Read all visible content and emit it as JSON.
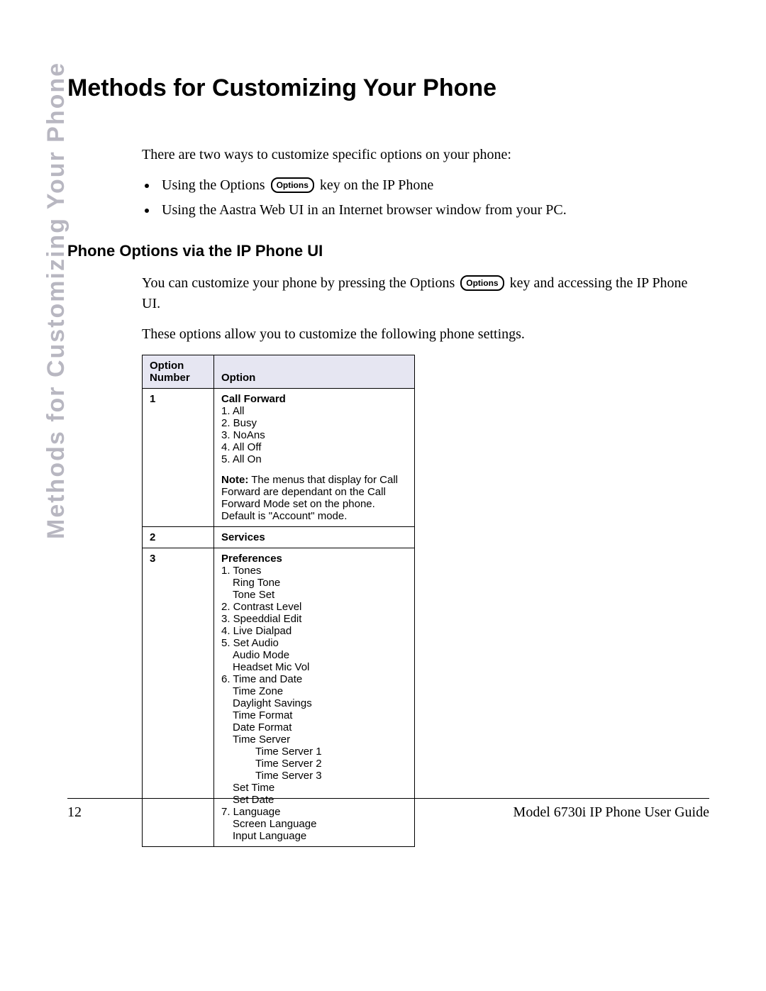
{
  "sidetab": "Methods for Customizing Your Phone",
  "title": "Methods for Customizing Your Phone",
  "intro": "There are two ways to customize specific options on your phone:",
  "bullet1_pre": "Using the Options ",
  "bullet1_post": " key on the IP Phone",
  "bullet2": "Using the Aastra Web UI in an Internet browser window from your PC.",
  "options_badge": "Options",
  "subheading": "Phone Options via the IP Phone UI",
  "para1_pre": "You can customize your phone by pressing the Options ",
  "para1_post": " key and accessing the IP Phone UI.",
  "para2": "These options allow you to customize the following phone settings.",
  "table": {
    "th1": "Option Number",
    "th2": "Option",
    "rows": [
      {
        "num": "1",
        "title": "Call Forward",
        "items": [
          "1. All",
          "2. Busy",
          "3. NoAns",
          "4. All Off",
          "5. All On"
        ],
        "note_label": "Note:",
        "note": " The menus that display for Call Forward are dependant on the Call Forward Mode set on the phone. Default is \"Account\" mode."
      },
      {
        "num": "2",
        "title": "Services"
      },
      {
        "num": "3",
        "title": "Preferences",
        "tree": [
          {
            "t": "1. Tones",
            "lvl": 0
          },
          {
            "t": "Ring Tone",
            "lvl": 1
          },
          {
            "t": "Tone Set",
            "lvl": 1
          },
          {
            "t": "2. Contrast Level",
            "lvl": 0
          },
          {
            "t": "3. Speeddial Edit",
            "lvl": 0
          },
          {
            "t": "4. Live Dialpad",
            "lvl": 0
          },
          {
            "t": "5. Set Audio",
            "lvl": 0
          },
          {
            "t": "Audio Mode",
            "lvl": 1
          },
          {
            "t": "Headset Mic Vol",
            "lvl": 1
          },
          {
            "t": "6. Time and Date",
            "lvl": 0
          },
          {
            "t": "Time Zone",
            "lvl": 1
          },
          {
            "t": "Daylight Savings",
            "lvl": 1
          },
          {
            "t": "Time Format",
            "lvl": 1
          },
          {
            "t": "Date Format",
            "lvl": 1
          },
          {
            "t": "Time Server",
            "lvl": 1
          },
          {
            "t": "Time Server 1",
            "lvl": 2
          },
          {
            "t": "Time Server 2",
            "lvl": 2
          },
          {
            "t": "Time Server 3",
            "lvl": 2
          },
          {
            "t": "Set Time",
            "lvl": 1
          },
          {
            "t": "Set Date",
            "lvl": 1
          },
          {
            "t": "7. Language",
            "lvl": 0
          },
          {
            "t": "Screen Language",
            "lvl": 1
          },
          {
            "t": "Input Language",
            "lvl": 1
          }
        ]
      }
    ]
  },
  "footer": {
    "page": "12",
    "doc": "Model 6730i IP Phone User Guide"
  }
}
